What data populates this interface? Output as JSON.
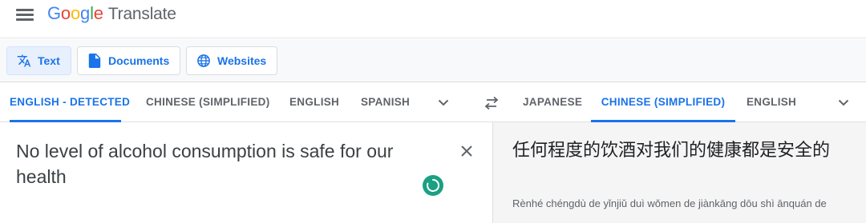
{
  "app": {
    "logo_letters": [
      "G",
      "o",
      "o",
      "g",
      "l",
      "e"
    ],
    "product_name": "Translate"
  },
  "modes": {
    "text": "Text",
    "documents": "Documents",
    "websites": "Websites",
    "active": "text"
  },
  "source_languages": {
    "tabs": [
      "ENGLISH - DETECTED",
      "CHINESE (SIMPLIFIED)",
      "ENGLISH",
      "SPANISH"
    ],
    "active_index": 0
  },
  "target_languages": {
    "tabs": [
      "JAPANESE",
      "CHINESE (SIMPLIFIED)",
      "ENGLISH"
    ],
    "active_index": 1
  },
  "source": {
    "text": "No level of alcohol consumption is safe for our health"
  },
  "target": {
    "text": "任何程度的饮酒对我们的健康都是安全的",
    "romanization": "Rènhé chéngdù de yǐnjiǔ duì wǒmen de jiànkāng dōu shì ānquán de"
  },
  "colors": {
    "accent": "#1a73e8",
    "active_mode_bg": "#e8f0fe",
    "listen_button": "#1aa082",
    "target_panel_bg": "#f5f5f5"
  },
  "icons": {
    "menu": "hamburger-menu-icon",
    "text_mode": "translate-icon",
    "documents_mode": "document-icon",
    "websites_mode": "globe-icon",
    "swap": "swap-languages-icon",
    "more_languages": "chevron-down-icon",
    "clear": "close-icon",
    "listen": "loading-icon"
  }
}
